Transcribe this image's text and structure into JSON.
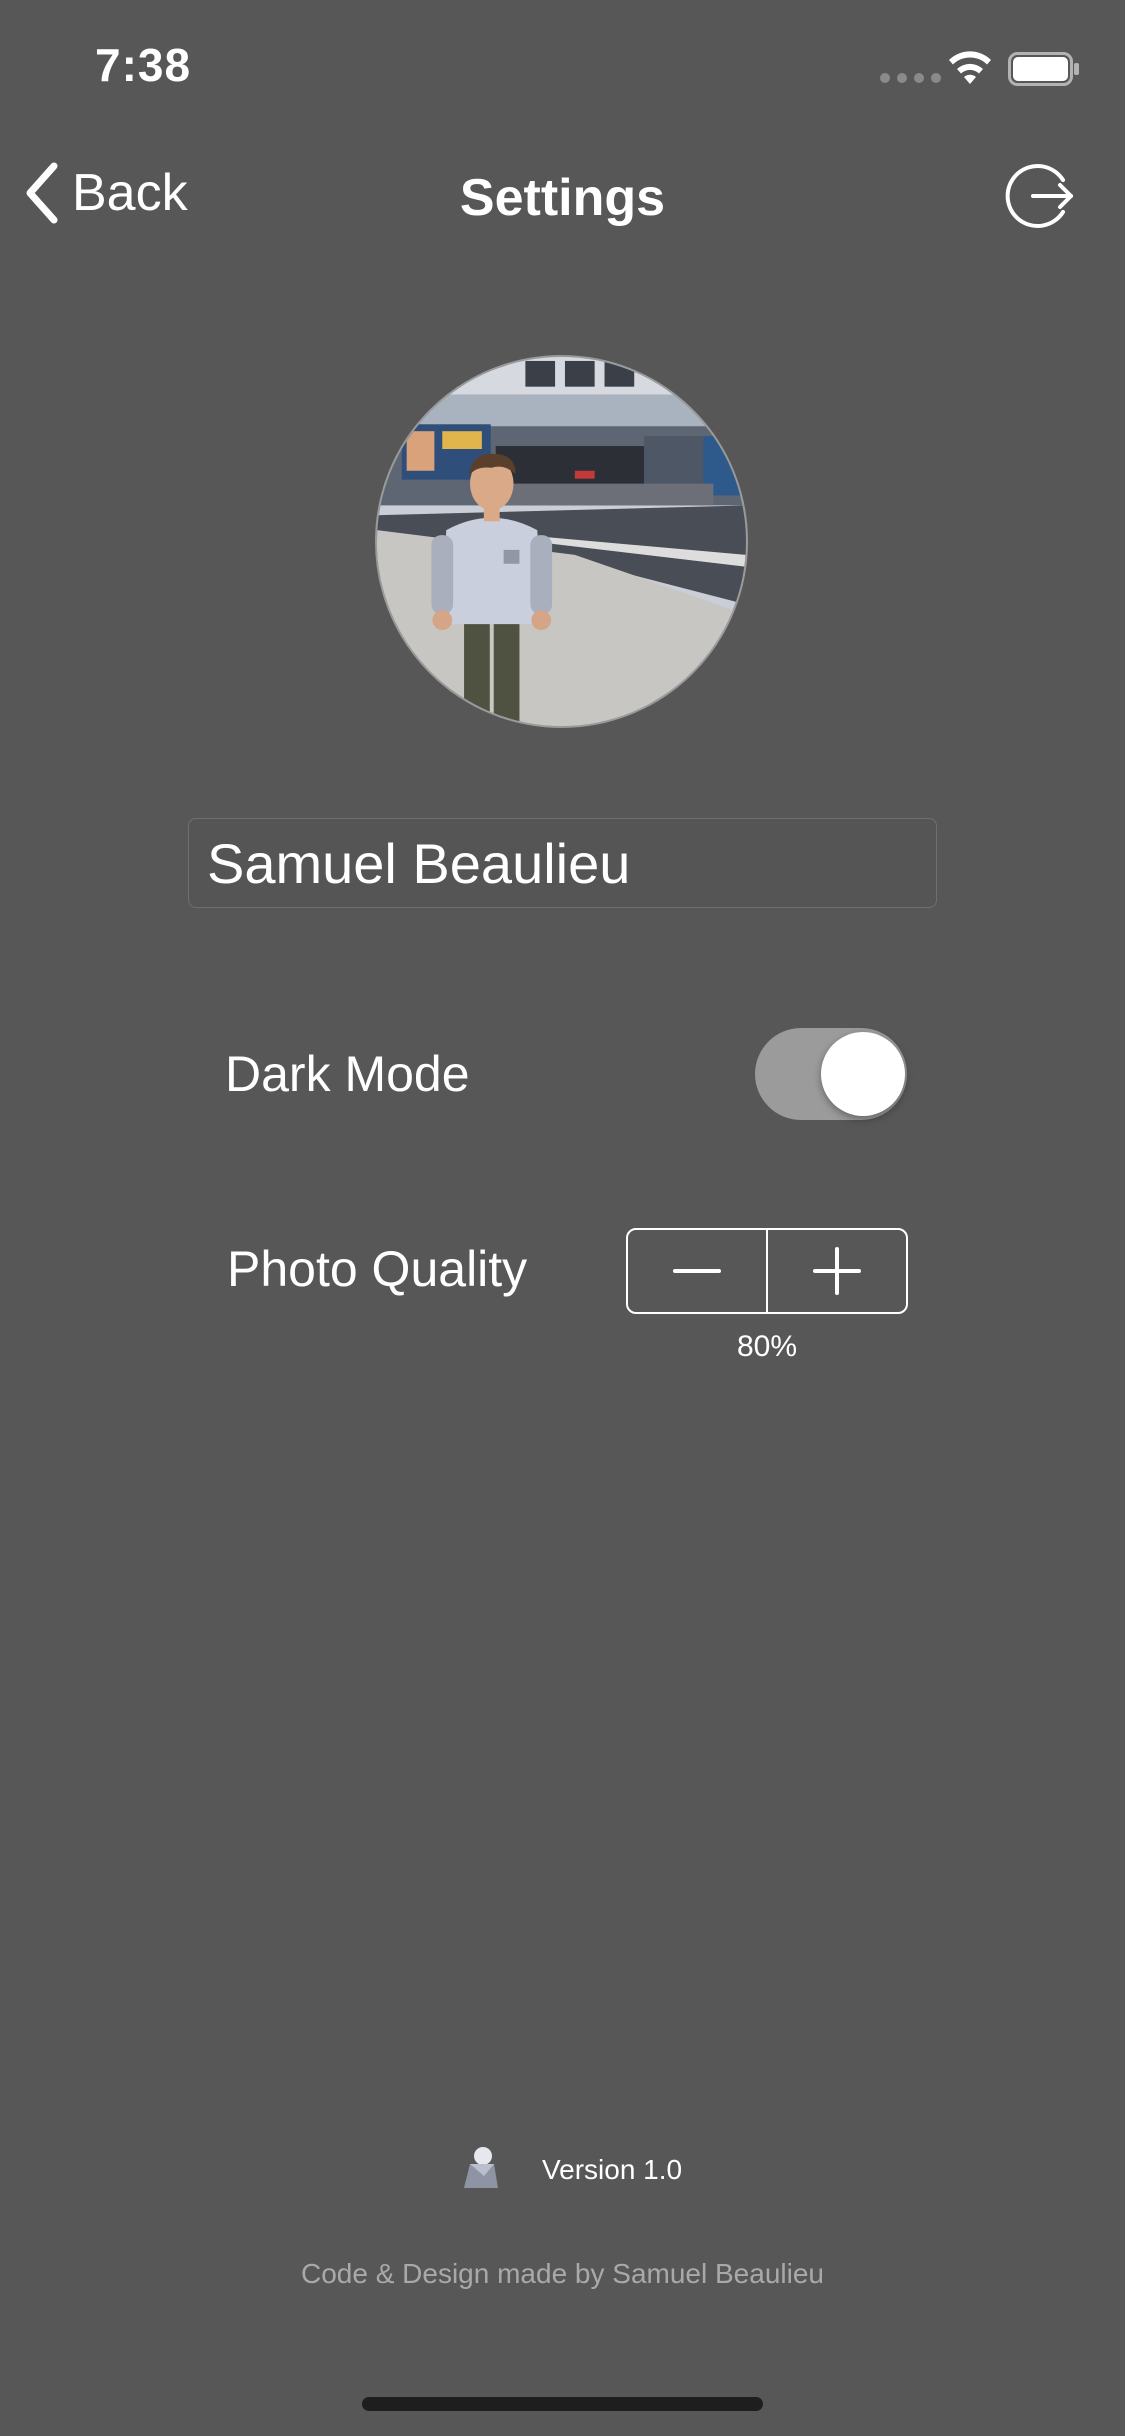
{
  "status_bar": {
    "time": "7:38"
  },
  "nav": {
    "back_label": "Back",
    "title": "Settings",
    "logout_icon": "logout-icon"
  },
  "profile": {
    "name_value": "Samuel Beaulieu"
  },
  "settings": {
    "dark_mode_label": "Dark Mode",
    "dark_mode_on": true,
    "photo_quality_label": "Photo Quality",
    "photo_quality_value": "80%",
    "decrement_icon": "minus-icon",
    "increment_icon": "plus-icon"
  },
  "footer": {
    "version": "Version 1.0",
    "credits": "Code & Design made by Samuel Beaulieu"
  },
  "colors": {
    "background": "#575757",
    "text": "#ffffff",
    "muted_text": "#a9a9a9",
    "toggle_track": "#9b9b9b"
  }
}
